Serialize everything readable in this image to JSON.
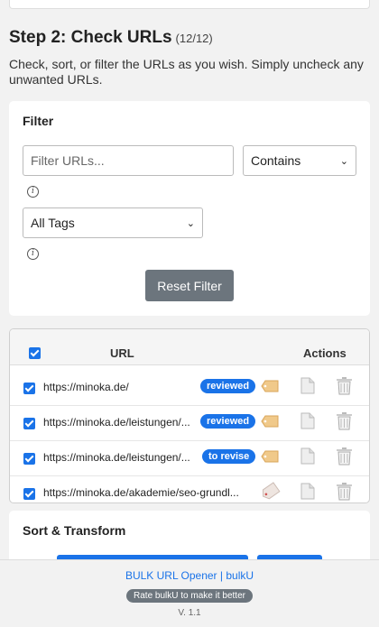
{
  "step": {
    "title": "Step 2: Check URLs",
    "count": "(12/12)",
    "description": "Check, sort, or filter the URLs as you wish. Simply uncheck any unwanted URLs."
  },
  "filter": {
    "heading": "Filter",
    "input_placeholder": "Filter URLs...",
    "match_mode": "Contains",
    "tags_select": "All Tags",
    "info_glyph": "i",
    "reset_label": "Reset Filter"
  },
  "table": {
    "col_url": "URL",
    "col_actions": "Actions",
    "rows": [
      {
        "url": "https://minoka.de/",
        "badge": "reviewed",
        "checked": true,
        "tag_color": "#f0c98a"
      },
      {
        "url": "https://minoka.de/leistungen/...",
        "badge": "reviewed",
        "checked": true,
        "tag_color": "#f0c98a"
      },
      {
        "url": "https://minoka.de/leistungen/...",
        "badge": "to revise",
        "checked": true,
        "tag_color": "#f0c98a"
      },
      {
        "url": "https://minoka.de/akademie/seo-grundl...",
        "badge": "",
        "checked": true,
        "tag_color": "#e8e0dc"
      }
    ]
  },
  "sort": {
    "heading": "Sort & Transform"
  },
  "footer": {
    "link": "BULK URL Opener | bulkU",
    "rate": "Rate bulkU to make it better",
    "version": "V. 1.1"
  },
  "colors": {
    "accent": "#1a73e8",
    "secondary": "#6c757d"
  }
}
